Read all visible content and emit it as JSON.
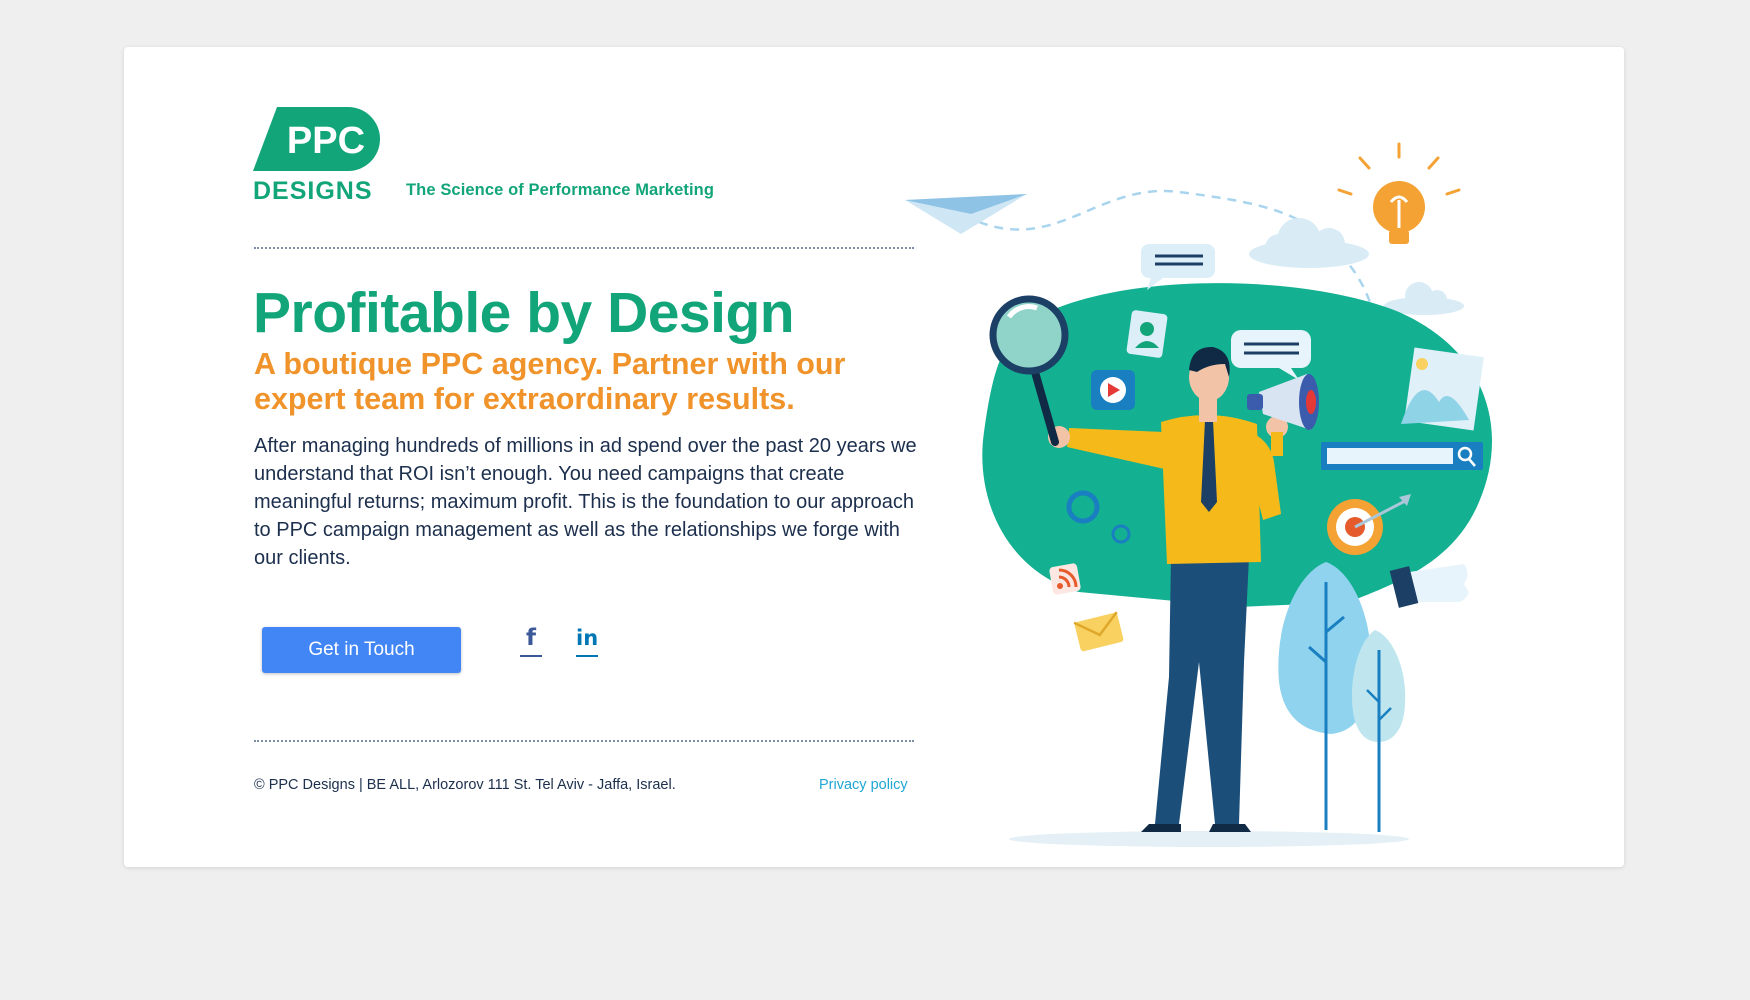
{
  "brand": {
    "logo_top": "PPC",
    "logo_bottom": "DESIGNS",
    "tagline": "The Science of Performance Marketing",
    "color_primary": "#13a57a",
    "color_accent": "#f0932a"
  },
  "hero": {
    "headline": "Profitable by Design",
    "subheadline": "A boutique PPC agency. Partner with our expert team for extraordinary results.",
    "body": "After managing hundreds of millions in ad spend over the past 20 years we understand that ROI isn’t enough. You need campaigns that create meaningful returns; maximum profit. This is the foundation to our approach to PPC campaign management as well as the relationships we forge with our clients."
  },
  "cta": {
    "label": "Get in Touch",
    "color": "#4286f5"
  },
  "social": [
    {
      "name": "facebook",
      "glyph": "f",
      "icon": "facebook-icon"
    },
    {
      "name": "linkedin",
      "glyph": "in",
      "icon": "linkedin-icon"
    }
  ],
  "footer": {
    "copyright": "© PPC Designs | BE ALL, Arlozorov 111 St. Tel Aviv - Jaffa, Israel.",
    "privacy": "Privacy policy"
  }
}
